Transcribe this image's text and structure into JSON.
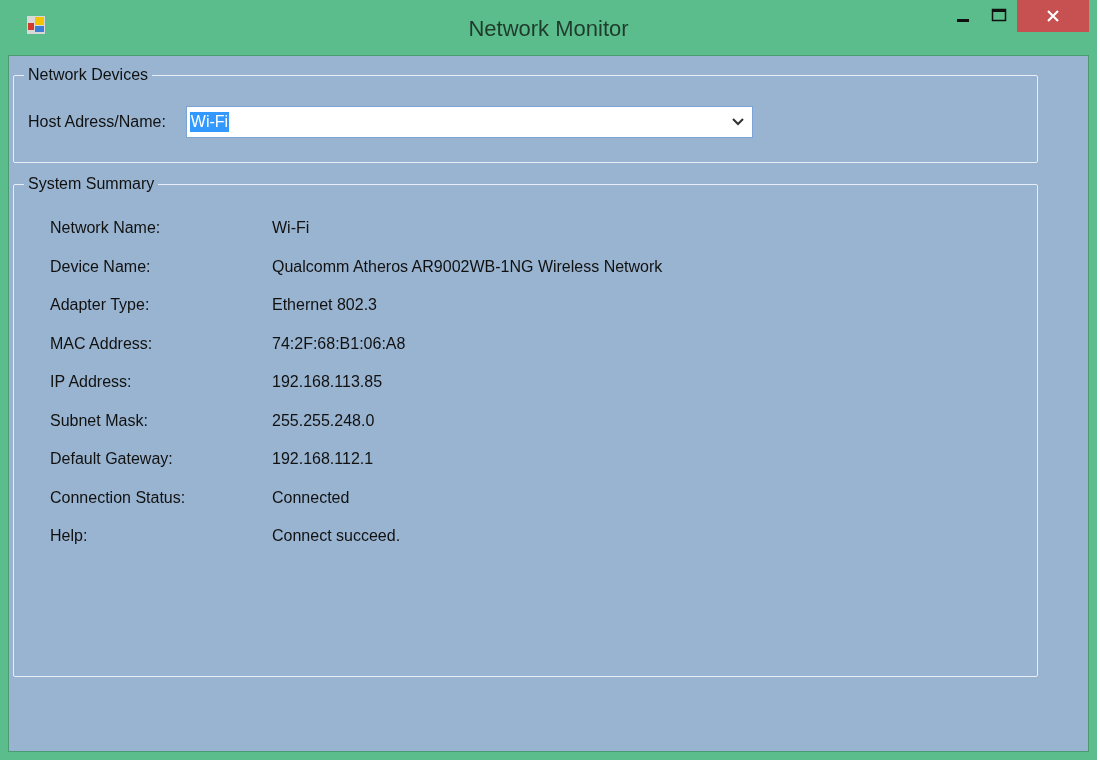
{
  "window": {
    "title": "Network Monitor"
  },
  "network_devices": {
    "title": "Network Devices",
    "host_label": "Host Adress/Name:",
    "host_field": {
      "value": "Wi-Fi",
      "text_selected": true
    }
  },
  "system_summary": {
    "title": "System Summary",
    "rows": [
      {
        "label": "Network Name:",
        "value": "Wi-Fi"
      },
      {
        "label": "Device Name:",
        "value": "Qualcomm Atheros AR9002WB-1NG Wireless Network"
      },
      {
        "label": "Adapter Type:",
        "value": "Ethernet 802.3"
      },
      {
        "label": "MAC Address:",
        "value": "74:2F:68:B1:06:A8"
      },
      {
        "label": "IP Address:",
        "value": "192.168.113.85"
      },
      {
        "label": "Subnet Mask:",
        "value": "255.255.248.0"
      },
      {
        "label": "Default Gateway:",
        "value": "192.168.112.1"
      },
      {
        "label": "Connection Status:",
        "value": "Connected"
      },
      {
        "label": "Help:",
        "value": "Connect succeed."
      }
    ]
  }
}
